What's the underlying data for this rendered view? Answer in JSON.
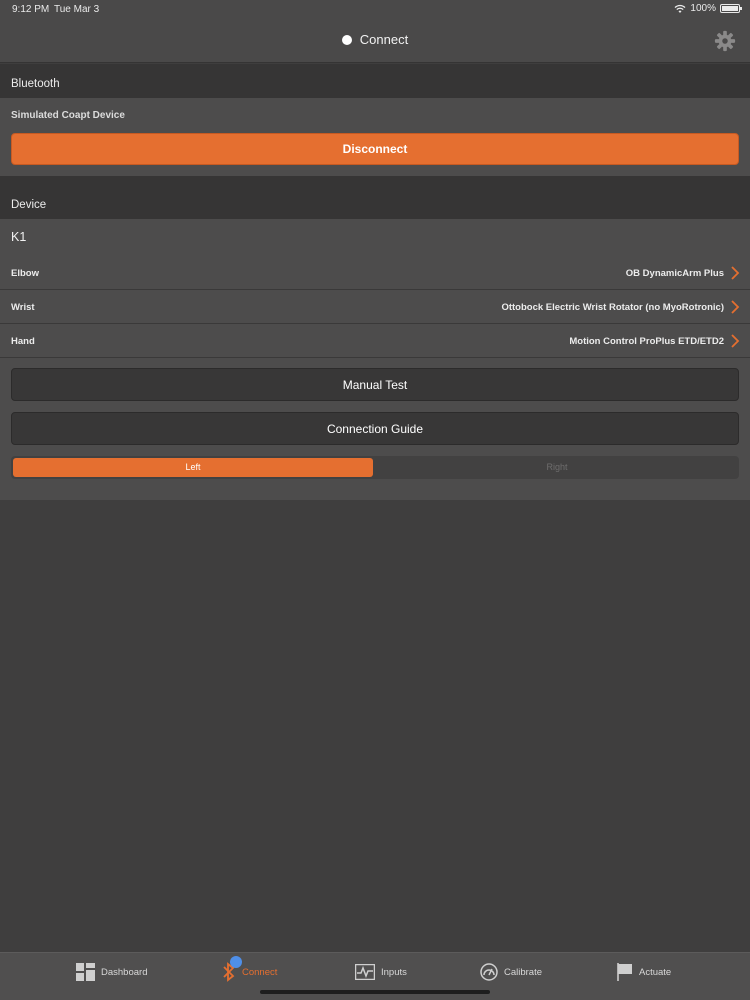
{
  "status_bar": {
    "time": "9:12 PM",
    "date": "Tue Mar 3",
    "battery": "100%",
    "icons": [
      "wifi-icon",
      "battery-icon"
    ]
  },
  "nav": {
    "title": "Connect",
    "settings_icon": "gear-icon"
  },
  "bluetooth": {
    "header": "Bluetooth",
    "device_name": "Simulated Coapt Device",
    "disconnect_label": "Disconnect"
  },
  "device": {
    "header": "Device",
    "name": "K1",
    "rows": [
      {
        "label": "Elbow",
        "value": "OB DynamicArm Plus"
      },
      {
        "label": "Wrist",
        "value": "Ottobock Electric Wrist Rotator (no MyoRotronic)"
      },
      {
        "label": "Hand",
        "value": "Motion Control ProPlus ETD/ETD2"
      }
    ],
    "manual_test_label": "Manual Test",
    "connection_guide_label": "Connection Guide",
    "side": {
      "options": [
        "Left",
        "Right"
      ],
      "selected": "Left"
    }
  },
  "tabs": [
    {
      "label": "Dashboard",
      "icon": "dashboard-icon",
      "active": false
    },
    {
      "label": "Connect",
      "icon": "bluetooth-icon",
      "active": true
    },
    {
      "label": "Inputs",
      "icon": "waveform-icon",
      "active": false
    },
    {
      "label": "Calibrate",
      "icon": "gauge-icon",
      "active": false
    },
    {
      "label": "Actuate",
      "icon": "flag-icon",
      "active": false
    }
  ],
  "colors": {
    "accent": "#e56f30",
    "background": "#3f3e3e",
    "badge": "#4f8fe8"
  }
}
